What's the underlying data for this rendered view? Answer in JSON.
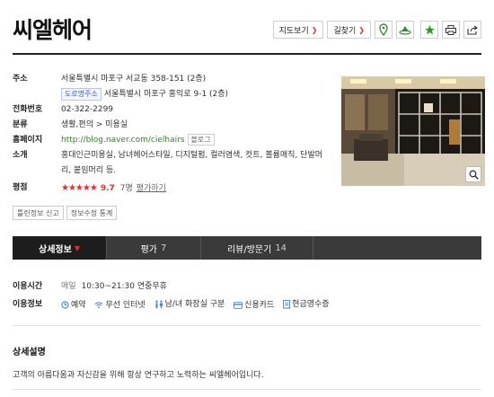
{
  "place": {
    "name": "씨엘헤어"
  },
  "actions": {
    "map_view": "지도보기",
    "directions": "길찾기"
  },
  "info": {
    "address_label": "주소",
    "address": "서울특별시 마포구 서교동 358-151 (2층)",
    "road_tag": "도로명주소",
    "road_address": "서울특별시 마포구 홍익로 9-1 (2층)",
    "phone_label": "전화번호",
    "phone": "02-322-2299",
    "category_label": "분류",
    "category": "생활,편의 > 미용실",
    "homepage_label": "홈페이지",
    "homepage_url": "http://blog.naver.com/cielhairs",
    "blog_tag": "블로그",
    "intro_label": "소개",
    "intro": "홍대인근미용실, 남녀헤어스타일, 디지털펌, 컬러염색, 컷트, 볼륨매직, 단발머리, 붙임머리 등.",
    "rating_label": "평점",
    "stars": "★★★★★",
    "score": "9.7",
    "rating_count": "7명",
    "rate_link": "평가하기"
  },
  "sub_buttons": {
    "report": "틀린정보 신고",
    "stats": "정보수정 통계"
  },
  "tabs": [
    {
      "label": "상세정보",
      "count": ""
    },
    {
      "label": "평가",
      "count": "7"
    },
    {
      "label": "리뷰/방문기",
      "count": "14"
    }
  ],
  "usage": {
    "hours_label": "이용시간",
    "hours_day": "매일",
    "hours": "10:30~21:30 연중무휴",
    "amenity_label": "이용정보",
    "amenities": [
      "예약",
      "무선 인터넷",
      "남/녀 화장실 구분",
      "신용카드",
      "현금영수증"
    ]
  },
  "description": {
    "title": "상세설명",
    "text": "고객의 아름다움과 자신감을 위해 항상 연구하고 노력하는 씨엘헤어입니다."
  },
  "colors": {
    "accent_red": "#e3302f",
    "link_green": "#2f8a1f",
    "tab_bar": "#3a3a3a"
  }
}
